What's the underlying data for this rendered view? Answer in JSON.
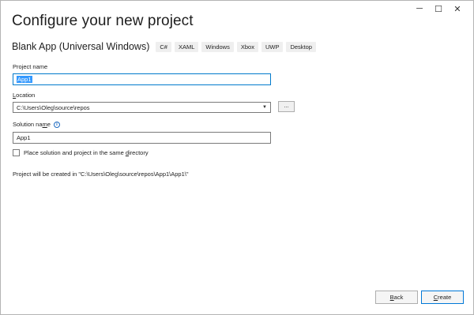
{
  "window_controls": {
    "minimize": "─",
    "maximize": "☐",
    "close": "✕"
  },
  "page_title": "Configure your new project",
  "template": {
    "name": "Blank App (Universal Windows)",
    "tags": [
      "C#",
      "XAML",
      "Windows",
      "Xbox",
      "UWP",
      "Desktop"
    ]
  },
  "project_name": {
    "label": "Project name",
    "value": "App1"
  },
  "location": {
    "label_prefix": "",
    "label_access": "L",
    "label_rest": "ocation",
    "value": "C:\\Users\\Oleg\\source\\repos",
    "browse_label": "..."
  },
  "solution_name": {
    "label_prefix": "Solution na",
    "label_access": "m",
    "label_rest": "e",
    "value": "App1"
  },
  "same_directory": {
    "label_prefix": "Place solution and project in the same ",
    "label_access": "d",
    "label_rest": "irectory",
    "checked": false
  },
  "creation_note": "Project will be created in \"C:\\Users\\Oleg\\source\\repos\\App1\\App1\\\"",
  "buttons": {
    "back_access": "B",
    "back_rest": "ack",
    "create_access": "C",
    "create_rest": "reate"
  }
}
